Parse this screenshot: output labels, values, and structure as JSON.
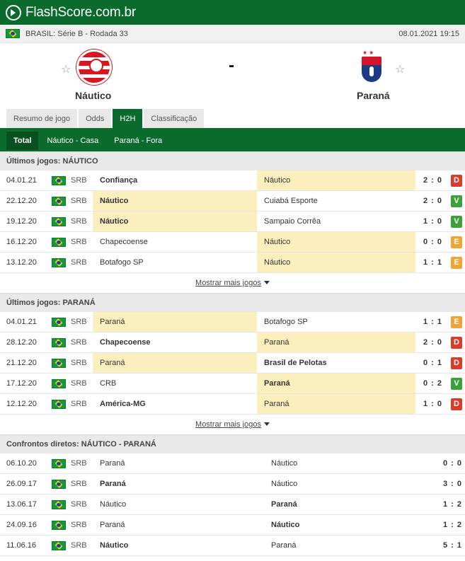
{
  "app": {
    "logo_text": "FlashScore.com.br"
  },
  "league": {
    "name": "BRASIL: Série B - Rodada 33",
    "datetime": "08.01.2021 19:15"
  },
  "match": {
    "home": "Náutico",
    "away": "Paraná",
    "score": "-",
    "star_icon": "☆"
  },
  "tabs": [
    {
      "label": "Resumo de jogo"
    },
    {
      "label": "Odds"
    },
    {
      "label": "H2H"
    },
    {
      "label": "Classificação"
    }
  ],
  "subtabs": [
    {
      "label": "Total"
    },
    {
      "label": "Náutico - Casa"
    },
    {
      "label": "Paraná - Fora"
    }
  ],
  "more_label": "Mostrar mais jogos",
  "sections": {
    "home_last": {
      "title": "Últimos jogos: NÁUTICO",
      "rows": [
        {
          "date": "04.01.21",
          "comp": "SRB",
          "home": "Confiança",
          "away": "Náutico",
          "score": "2 : 0",
          "result": "D"
        },
        {
          "date": "22.12.20",
          "comp": "SRB",
          "home": "Náutico",
          "away": "Cuiabá Esporte",
          "score": "2 : 0",
          "result": "V"
        },
        {
          "date": "19.12.20",
          "comp": "SRB",
          "home": "Náutico",
          "away": "Sampaio Corrêa",
          "score": "1 : 0",
          "result": "V"
        },
        {
          "date": "16.12.20",
          "comp": "SRB",
          "home": "Chapecoense",
          "away": "Náutico",
          "score": "0 : 0",
          "result": "E"
        },
        {
          "date": "13.12.20",
          "comp": "SRB",
          "home": "Botafogo SP",
          "away": "Náutico",
          "score": "1 : 1",
          "result": "E"
        }
      ]
    },
    "away_last": {
      "title": "Últimos jogos: PARANÁ",
      "rows": [
        {
          "date": "04.01.21",
          "comp": "SRB",
          "home": "Paraná",
          "away": "Botafogo SP",
          "score": "1 : 1",
          "result": "E"
        },
        {
          "date": "28.12.20",
          "comp": "SRB",
          "home": "Chapecoense",
          "away": "Paraná",
          "score": "2 : 0",
          "result": "D"
        },
        {
          "date": "21.12.20",
          "comp": "SRB",
          "home": "Paraná",
          "away": "Brasil de Pelotas",
          "score": "0 : 1",
          "result": "D"
        },
        {
          "date": "17.12.20",
          "comp": "SRB",
          "home": "CRB",
          "away": "Paraná",
          "score": "0 : 2",
          "result": "V"
        },
        {
          "date": "12.12.20",
          "comp": "SRB",
          "home": "América-MG",
          "away": "Paraná",
          "score": "1 : 0",
          "result": "D"
        }
      ]
    },
    "h2h": {
      "title": "Confrontos diretos: NÁUTICO - PARANÁ",
      "rows": [
        {
          "date": "06.10.20",
          "comp": "SRB",
          "home": "Paraná",
          "away": "Náutico",
          "score": "0 : 0"
        },
        {
          "date": "26.09.17",
          "comp": "SRB",
          "home": "Paraná",
          "away": "Náutico",
          "score": "3 : 0"
        },
        {
          "date": "13.06.17",
          "comp": "SRB",
          "home": "Náutico",
          "away": "Paraná",
          "score": "1 : 2"
        },
        {
          "date": "24.09.16",
          "comp": "SRB",
          "home": "Paraná",
          "away": "Náutico",
          "score": "1 : 2"
        },
        {
          "date": "11.06.16",
          "comp": "SRB",
          "home": "Náutico",
          "away": "Paraná",
          "score": "5 : 1"
        }
      ]
    }
  },
  "colors": {
    "brand_green": "#0b6b2d",
    "win": "#3aa13b",
    "draw": "#f0a533",
    "loss": "#dc3b2c",
    "highlight": "#fcefbe"
  }
}
